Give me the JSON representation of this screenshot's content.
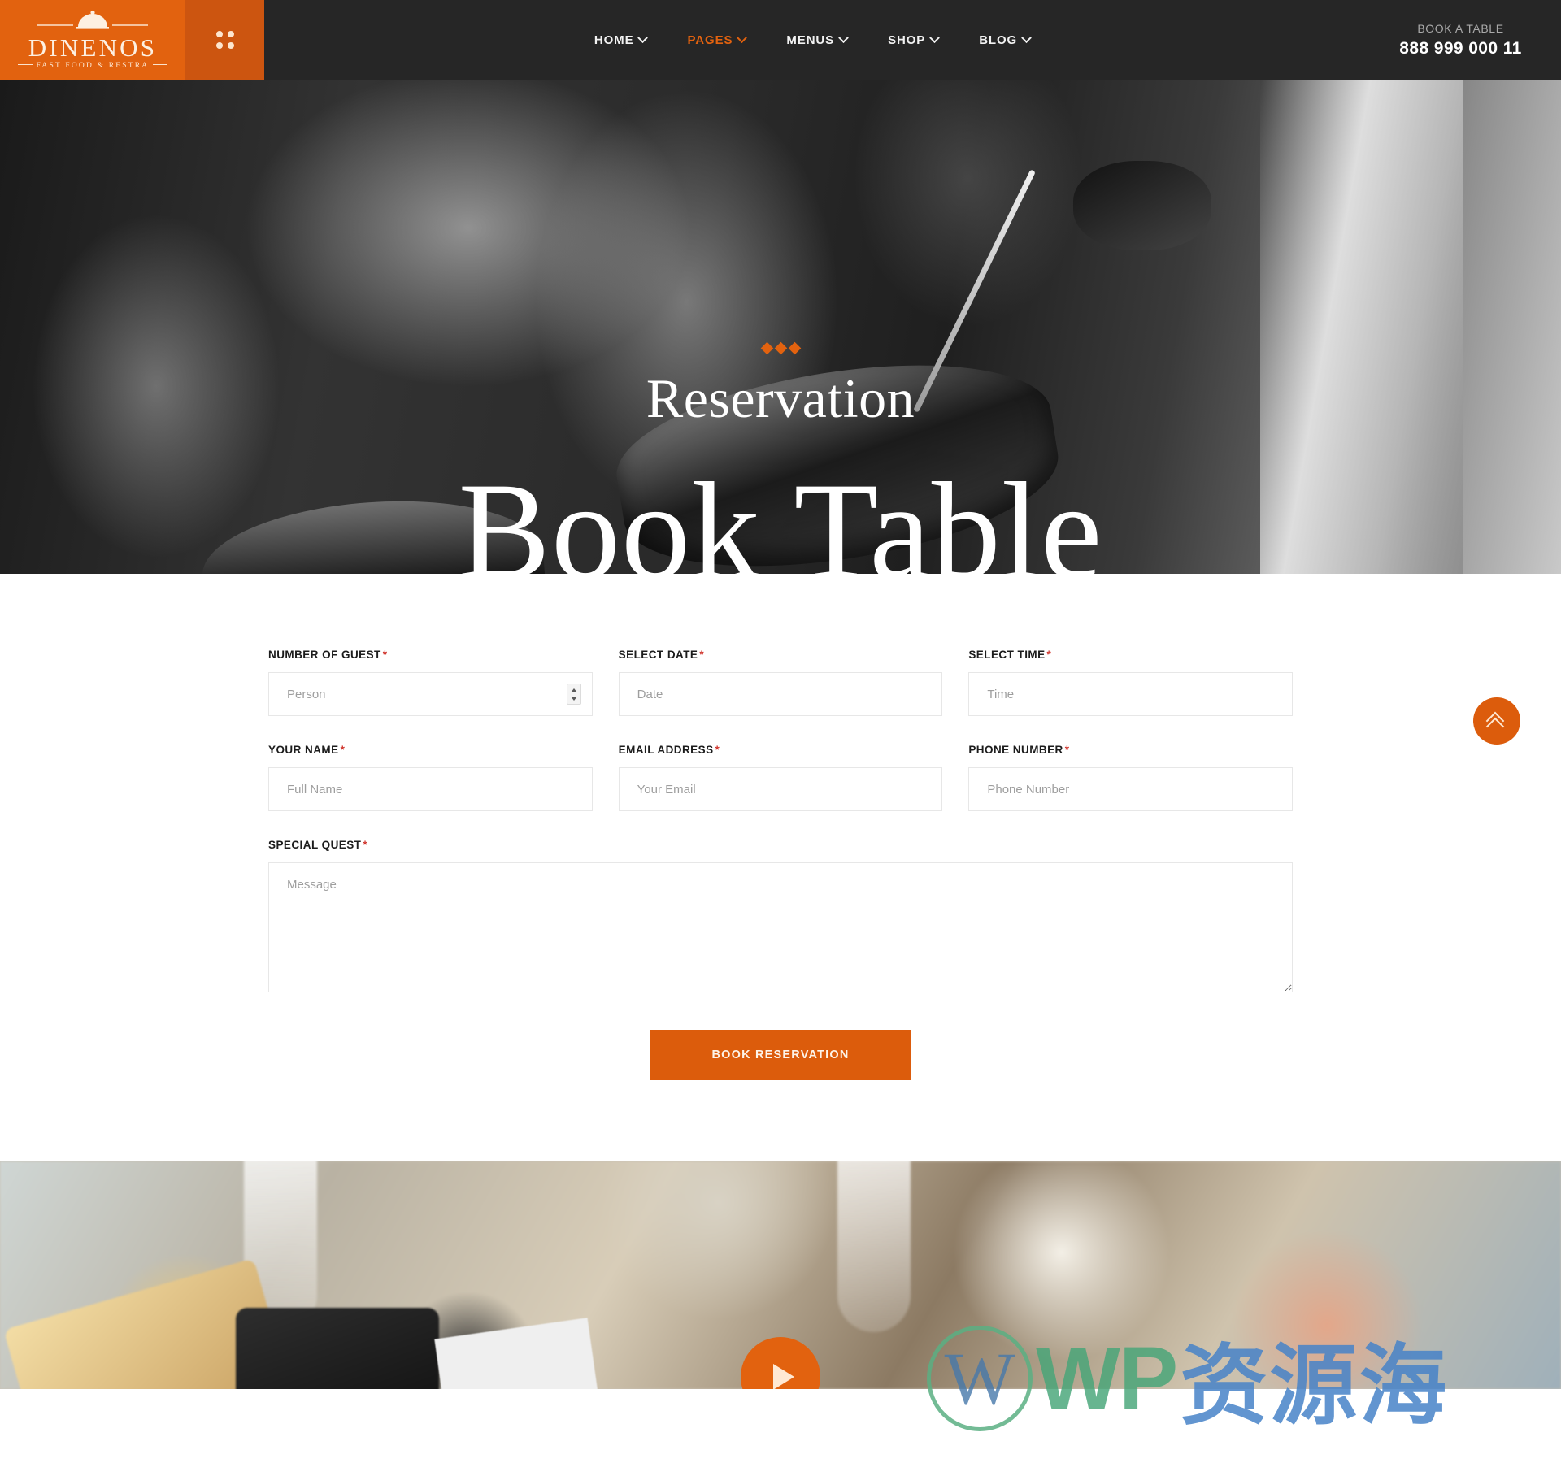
{
  "header": {
    "logo": {
      "name": "DINENOS",
      "tagline": "FAST FOOD & RESTRA",
      "icon": "dome-cloche-icon"
    },
    "grid_toggle_icon": "grid-dots-icon",
    "nav": [
      {
        "label": "HOME",
        "active": false,
        "has_dropdown": true
      },
      {
        "label": "PAGES",
        "active": true,
        "has_dropdown": true
      },
      {
        "label": "MENUS",
        "active": false,
        "has_dropdown": true
      },
      {
        "label": "SHOP",
        "active": false,
        "has_dropdown": true
      },
      {
        "label": "BLOG",
        "active": false,
        "has_dropdown": true
      }
    ],
    "cta": {
      "label": "BOOK A TABLE",
      "phone": "888 999 000 11"
    }
  },
  "hero": {
    "eyebrow_icon": "three-diamonds-icon",
    "subtitle": "Reservation",
    "title": "Book Table"
  },
  "form": {
    "fields": [
      {
        "label": "NUMBER OF GUEST",
        "required": "*",
        "placeholder": "Person",
        "type": "number"
      },
      {
        "label": "SELECT DATE",
        "required": "*",
        "placeholder": "Date",
        "type": "text"
      },
      {
        "label": "SELECT TIME",
        "required": "*",
        "placeholder": "Time",
        "type": "text"
      },
      {
        "label": "YOUR NAME",
        "required": "*",
        "placeholder": "Full Name",
        "type": "text"
      },
      {
        "label": "EMAIL ADDRESS",
        "required": "*",
        "placeholder": "Your Email",
        "type": "text"
      },
      {
        "label": "PHONE NUMBER",
        "required": "*",
        "placeholder": "Phone Number",
        "type": "text"
      }
    ],
    "message": {
      "label": "SPECIAL QUEST",
      "required": "*",
      "placeholder": "Message"
    },
    "submit_label": "BOOK RESERVATION"
  },
  "scroll_top": {
    "icon": "double-chevron-up-icon"
  },
  "bottom": {
    "play_icon": "play-triangle-icon"
  },
  "watermark": {
    "mark": "W",
    "wp": "WP",
    "cn": "资源海"
  },
  "colors": {
    "brand_orange": "#E2620F",
    "brand_orange_dark": "#CC5510",
    "button_orange": "#DC5C0C",
    "header_dark": "#262626",
    "required_red": "#d0342c"
  }
}
